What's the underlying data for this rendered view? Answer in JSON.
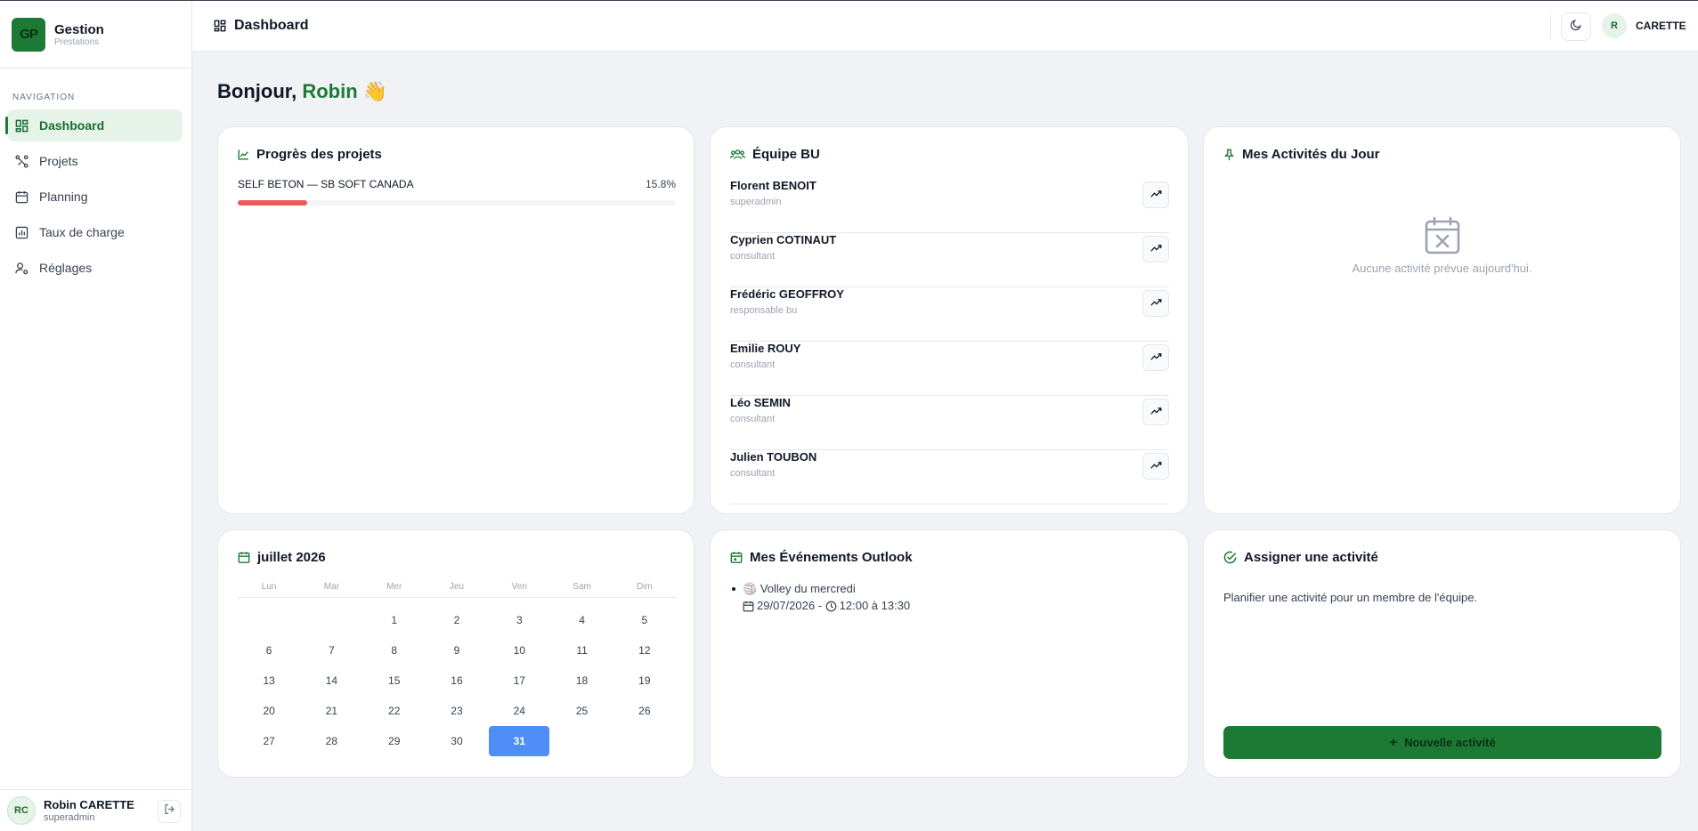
{
  "brand": {
    "logo": "GP",
    "title": "Gestion",
    "subtitle": "Prestations"
  },
  "sidebar": {
    "heading": "NAVIGATION",
    "items": [
      {
        "label": "Dashboard",
        "icon": "dashboard-icon",
        "active": true
      },
      {
        "label": "Projets",
        "icon": "projects-icon",
        "active": false
      },
      {
        "label": "Planning",
        "icon": "calendar-icon",
        "active": false
      },
      {
        "label": "Taux de charge",
        "icon": "bar-chart-icon",
        "active": false
      },
      {
        "label": "Réglages",
        "icon": "user-settings-icon",
        "active": false
      }
    ],
    "user": {
      "initials": "RC",
      "name": "Robin CARETTE",
      "role": "superadmin"
    }
  },
  "header": {
    "title": "Dashboard",
    "user_initial": "R",
    "user_name": "CARETTE"
  },
  "greeting": {
    "prefix": "Bonjour,",
    "name": "Robin",
    "emoji": "👋"
  },
  "projects_card": {
    "title": "Progrès des projets",
    "items": [
      {
        "name": "SELF BETON — SB SOFT CANADA",
        "percent_label": "15.8%",
        "percent": 15.8
      }
    ]
  },
  "team_card": {
    "title": "Équipe BU",
    "members": [
      {
        "name": "Florent BENOIT",
        "role": "superadmin"
      },
      {
        "name": "Cyprien COTINAUT",
        "role": "consultant"
      },
      {
        "name": "Frédéric GEOFFROY",
        "role": "responsable bu"
      },
      {
        "name": "Emilie ROUY",
        "role": "consultant"
      },
      {
        "name": "Léo SEMIN",
        "role": "consultant"
      },
      {
        "name": "Julien TOUBON",
        "role": "consultant"
      }
    ]
  },
  "activities_card": {
    "title": "Mes Activités du Jour",
    "empty_text": "Aucune activité prévue aujourd'hui."
  },
  "calendar": {
    "title": "juillet 2026",
    "weekdays": [
      "Lun",
      "Mar",
      "Mer",
      "Jeu",
      "Ven",
      "Sam",
      "Dim"
    ],
    "days": [
      "",
      "",
      "1",
      "2",
      "3",
      "4",
      "5",
      "6",
      "7",
      "8",
      "9",
      "10",
      "11",
      "12",
      "13",
      "14",
      "15",
      "16",
      "17",
      "18",
      "19",
      "20",
      "21",
      "22",
      "23",
      "24",
      "25",
      "26",
      "27",
      "28",
      "29",
      "30",
      "31"
    ],
    "selected_day": "31"
  },
  "outlook_card": {
    "title": "Mes Événements Outlook",
    "events": [
      {
        "emoji": "🏐",
        "title": "Volley du mercredi",
        "date": "29/07/2026 -",
        "time": "12:00 à 13:30"
      }
    ]
  },
  "assign_card": {
    "title": "Assigner une activité",
    "description": "Planifier une activité pour un membre de l'équipe.",
    "button_label": "Nouvelle activité"
  },
  "colors": {
    "accent": "#1d7a34",
    "accent_light": "#e5f3e8",
    "progress": "#ef5a5a",
    "selected_day": "#4f8ef7"
  }
}
